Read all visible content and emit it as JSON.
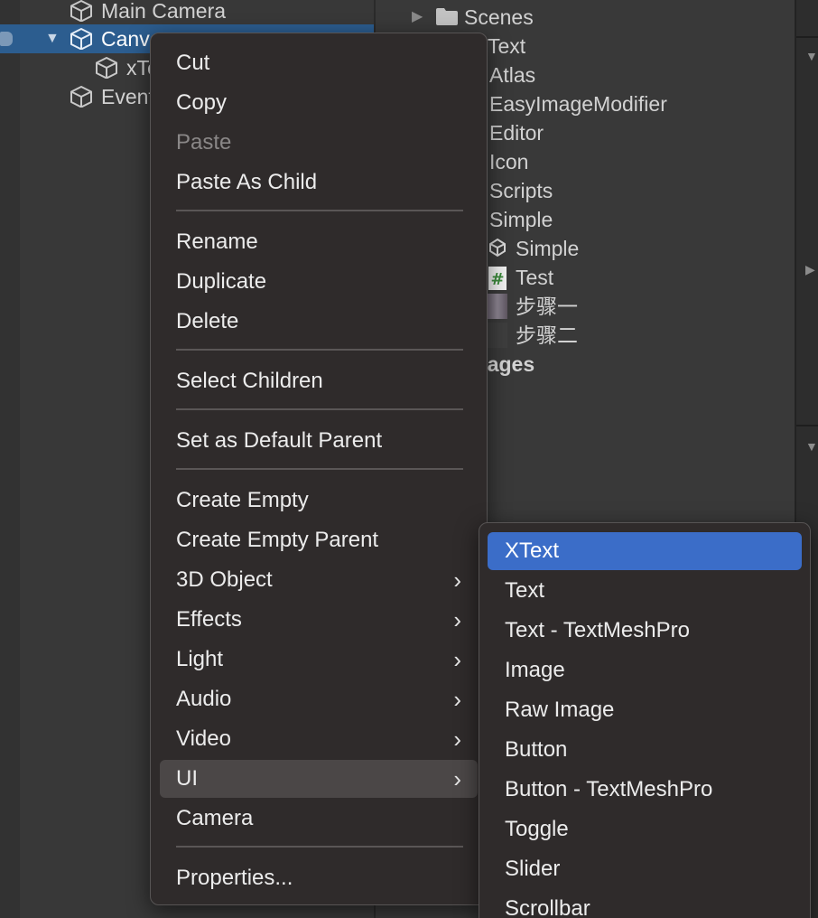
{
  "hierarchy": {
    "items": [
      {
        "label": "Main Camera"
      },
      {
        "label": "Canvas"
      },
      {
        "label": "xText"
      },
      {
        "label": "EventSystem"
      }
    ]
  },
  "project": {
    "items": [
      {
        "label": "Scenes"
      },
      {
        "label": "Text"
      },
      {
        "label": "Atlas"
      },
      {
        "label": "EasyImageModifier"
      },
      {
        "label": "Editor"
      },
      {
        "label": "Icon"
      },
      {
        "label": "Scripts"
      },
      {
        "label": "Simple"
      },
      {
        "label": "Simple"
      },
      {
        "label": "Test"
      },
      {
        "label": "步骤一"
      },
      {
        "label": "步骤二"
      },
      {
        "label": "Packages"
      }
    ]
  },
  "context_menu": {
    "items": [
      {
        "label": "Cut"
      },
      {
        "label": "Copy"
      },
      {
        "label": "Paste"
      },
      {
        "label": "Paste As Child"
      },
      {
        "label": "Rename"
      },
      {
        "label": "Duplicate"
      },
      {
        "label": "Delete"
      },
      {
        "label": "Select Children"
      },
      {
        "label": "Set as Default Parent"
      },
      {
        "label": "Create Empty"
      },
      {
        "label": "Create Empty Parent"
      },
      {
        "label": "3D Object"
      },
      {
        "label": "Effects"
      },
      {
        "label": "Light"
      },
      {
        "label": "Audio"
      },
      {
        "label": "Video"
      },
      {
        "label": "UI"
      },
      {
        "label": "Camera"
      },
      {
        "label": "Properties..."
      }
    ],
    "submenu_chevron": "›"
  },
  "ui_submenu": {
    "items": [
      {
        "label": "XText"
      },
      {
        "label": "Text"
      },
      {
        "label": "Text - TextMeshPro"
      },
      {
        "label": "Image"
      },
      {
        "label": "Raw Image"
      },
      {
        "label": "Button"
      },
      {
        "label": "Button - TextMeshPro"
      },
      {
        "label": "Toggle"
      },
      {
        "label": "Slider"
      },
      {
        "label": "Scrollbar"
      }
    ]
  },
  "colors": {
    "selection": "#2c5d8f",
    "menu_bg": "#2f2b2b",
    "submenu_highlight": "#3b6dc8",
    "script_icon": "#3c8a3c"
  },
  "icons": {
    "gameobject": "cube-icon",
    "folder": "folder-icon",
    "scene": "unity-scene-icon",
    "script": "csharp-script-icon",
    "image": "image-thumbnail-icon",
    "submenu": "chevron-right-icon"
  }
}
